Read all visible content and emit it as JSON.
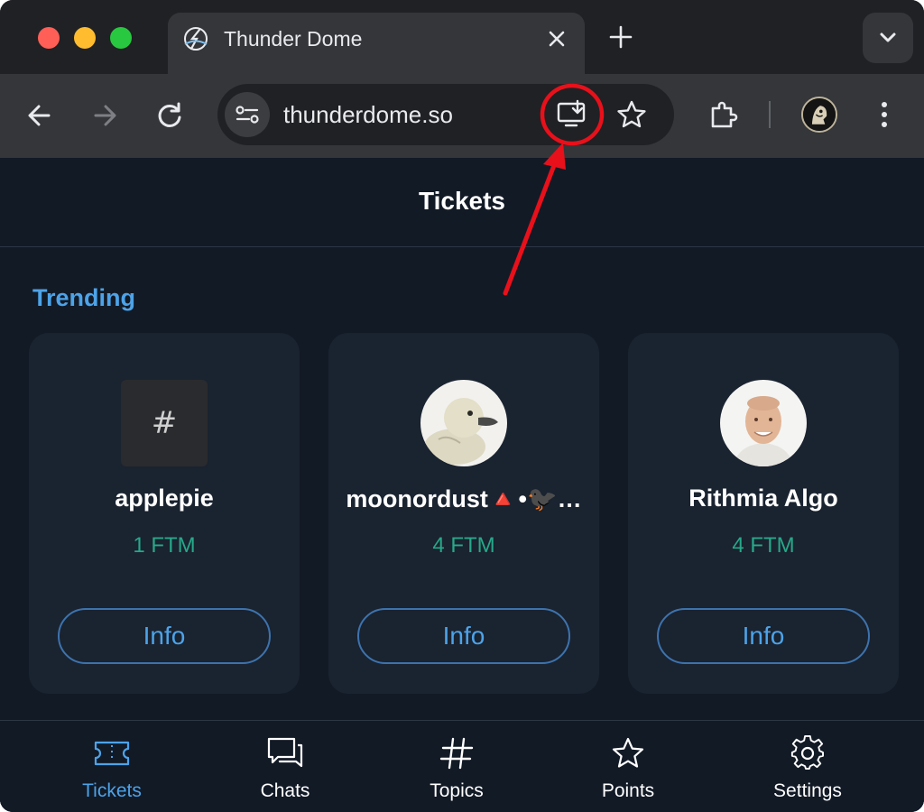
{
  "browser": {
    "tab": {
      "title": "Thunder Dome",
      "favicon": "thunderdome-logo-icon"
    },
    "address_bar": {
      "url": "thunderdome.so"
    },
    "toolbar_icons": [
      "back-icon",
      "forward-icon",
      "reload-icon",
      "site-info-icon",
      "install-app-icon",
      "bookmark-star-icon",
      "extensions-icon",
      "profile-avatar",
      "menu-icon"
    ]
  },
  "page": {
    "title": "Tickets",
    "section_title": "Trending",
    "cards": [
      {
        "name": "applepie",
        "price": "1 FTM",
        "button": "Info",
        "avatar": "hash-placeholder"
      },
      {
        "name": "moonordust🔺•🐦‍⬛…",
        "price": "4 FTM",
        "button": "Info",
        "avatar": "duck-avatar"
      },
      {
        "name": "Rithmia Algo",
        "price": "4 FTM",
        "button": "Info",
        "avatar": "person-avatar"
      }
    ],
    "bottom_nav": [
      {
        "label": "Tickets",
        "icon": "ticket-icon",
        "active": true
      },
      {
        "label": "Chats",
        "icon": "chats-icon",
        "active": false
      },
      {
        "label": "Topics",
        "icon": "hashtag-icon",
        "active": false
      },
      {
        "label": "Points",
        "icon": "star-icon",
        "active": false
      },
      {
        "label": "Settings",
        "icon": "gear-icon",
        "active": false
      }
    ]
  },
  "colors": {
    "accent": "#4da3e8",
    "price": "#27a88a",
    "page_bg": "#121a26",
    "card_bg": "#1a2330",
    "annotation": "#e8101a"
  }
}
